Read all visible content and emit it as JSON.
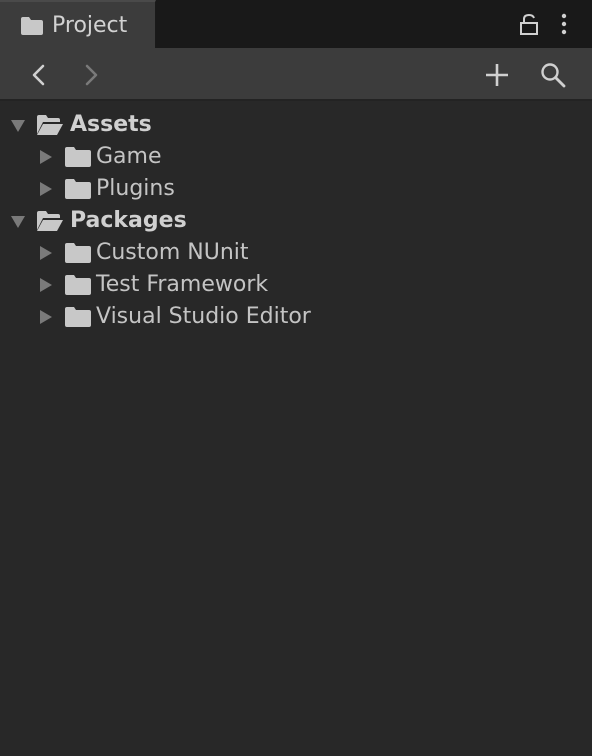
{
  "window": {
    "tab": {
      "label": "Project",
      "icon": "folder-icon"
    },
    "header_icons": [
      "lock-icon",
      "kebab-menu-icon"
    ]
  },
  "toolbar": {
    "buttons": [
      "back-arrow-icon",
      "forward-arrow-icon",
      "plus-icon",
      "search-icon"
    ]
  },
  "tree": {
    "roots": [
      {
        "label": "Assets",
        "expanded": true,
        "children": [
          {
            "label": "Game",
            "expanded": false
          },
          {
            "label": "Plugins",
            "expanded": false
          }
        ]
      },
      {
        "label": "Packages",
        "expanded": true,
        "children": [
          {
            "label": "Custom NUnit",
            "expanded": false
          },
          {
            "label": "Test Framework",
            "expanded": false
          },
          {
            "label": "Visual Studio Editor",
            "expanded": false
          }
        ]
      }
    ]
  },
  "colors": {
    "background": "#282828",
    "toolbar": "#3c3c3c",
    "tabbar": "#191919",
    "text": "#c4c4c4",
    "icon": "#c8c8c8",
    "arrow": "#7a7a7a"
  }
}
